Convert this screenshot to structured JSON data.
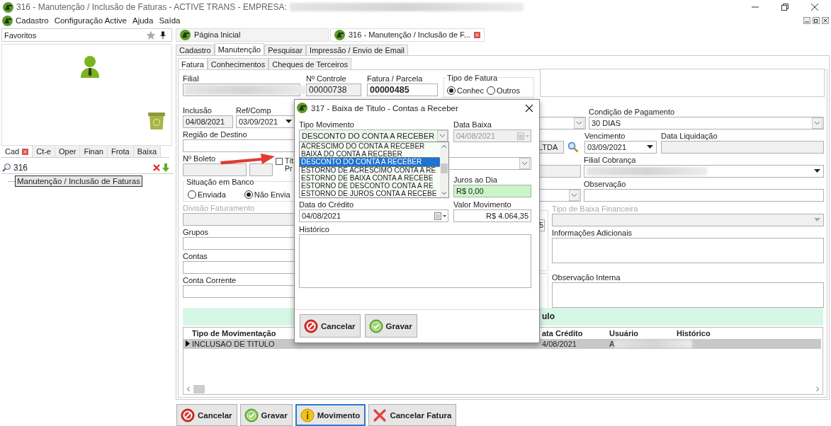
{
  "window": {
    "title": "316 - Manutenção / Inclusão de Faturas - ACTIVE TRANS - EMPRESA:"
  },
  "menu": [
    {
      "label": "Cadastro"
    },
    {
      "label": "Configuração Active"
    },
    {
      "label": "Ajuda"
    },
    {
      "label": "Saída"
    }
  ],
  "favorites": {
    "title": "Favoritos"
  },
  "side_tabs": [
    {
      "label": "Cad",
      "selected": true,
      "closable": true
    },
    {
      "label": "Ct-e",
      "selected": false,
      "closable": false
    },
    {
      "label": "Oper",
      "selected": false,
      "closable": false
    },
    {
      "label": "Finan",
      "selected": false,
      "closable": false
    },
    {
      "label": "Frota",
      "selected": false,
      "closable": false
    },
    {
      "label": "Baixa",
      "selected": false,
      "closable": false
    }
  ],
  "side_search": {
    "value": "316"
  },
  "tree": [
    {
      "label": "Manutenção / Inclusão de Faturas",
      "selected": true
    }
  ],
  "doc_tabs": [
    {
      "label": "Página Inicial",
      "selected": false,
      "closable": false
    },
    {
      "label": "316 - Manutenção / Inclusão de F...",
      "selected": true,
      "closable": true
    }
  ],
  "tabs": [
    {
      "label": "Cadastro",
      "selected": false
    },
    {
      "label": "Manutenção",
      "selected": true
    },
    {
      "label": "Pesquisar",
      "selected": false
    },
    {
      "label": "Impressão / Envio de Email",
      "selected": false
    }
  ],
  "subtabs": [
    {
      "label": "Fatura",
      "selected": true
    },
    {
      "label": "Conhecimentos",
      "selected": false
    },
    {
      "label": "Cheques de Terceiros",
      "selected": false
    }
  ],
  "form": {
    "filial": {
      "label": "Filial"
    },
    "controle": {
      "label": "Nº Controle",
      "value": "00000738"
    },
    "fatura_parcela": {
      "label": "Fatura / Parcela",
      "value": "00000485"
    },
    "tipo_fatura": {
      "label": "Tipo de Fatura",
      "options": [
        {
          "label": "Conhec",
          "selected": true
        },
        {
          "label": "Outros",
          "selected": false
        }
      ]
    },
    "inclusao": {
      "label": "Inclusão",
      "value": "04/08/2021"
    },
    "ref_comp": {
      "label": "Ref/Comp",
      "value": "03/09/2021"
    },
    "regiao_destino": {
      "label": "Região de Destino"
    },
    "boleto": {
      "label": "Nº Boleto"
    },
    "titulo_check": {
      "lines": [
        "Tít",
        "Pr"
      ],
      "checked": false
    },
    "situacao_banco": {
      "label": "Situação em Banco",
      "options": [
        {
          "label": "Enviada",
          "selected": false
        },
        {
          "label": "Não Envia",
          "selected": true
        }
      ]
    },
    "divisao": {
      "label": "Divisão Faturamento",
      "disabled": true
    },
    "grupos": {
      "label": "Grupos"
    },
    "contas": {
      "label": "Contas"
    },
    "conta_corrente": {
      "label": "Conta Corrente"
    },
    "condicao": {
      "label": "Condição de Pagamento",
      "value": "30 DIAS"
    },
    "cliente_fragment": {
      "value": "LTDA"
    },
    "vencimento": {
      "label": "Vencimento",
      "value": "03/09/2021"
    },
    "data_liquidacao": {
      "label": "Data Liquidação"
    },
    "filial_cobranca": {
      "label": "Filial Cobrança"
    },
    "observacao": {
      "label": "Observação"
    },
    "valor_fragment": {
      "value": "5"
    },
    "tipo_baixa": {
      "label": "Tipo de Baixa Financeira",
      "disabled": true
    },
    "info_adicionais": {
      "label": "Informações Adicionais"
    },
    "obs_interna": {
      "label": "Observação Interna"
    }
  },
  "band": {
    "text": "ulo"
  },
  "table": {
    "columns": [
      "Tipo de Movimentação",
      "ata Crédito",
      "Usuário",
      "Histórico"
    ],
    "rows": [
      {
        "cells": [
          "INCLUSAO DE TITULO",
          "4/08/2021",
          "A"
        ],
        "selected": true
      }
    ]
  },
  "buttons": [
    {
      "label": "Cancelar",
      "kind": "cancel",
      "focused": false
    },
    {
      "label": "Gravar",
      "kind": "save",
      "focused": false
    },
    {
      "label": "Movimento",
      "kind": "info",
      "focused": true
    },
    {
      "label": "Cancelar Fatura",
      "kind": "delete",
      "focused": false
    }
  ],
  "dialog": {
    "title": "317 - Baixa de Titulo - Contas a Receber",
    "tipo_movimento": {
      "label": "Tipo Movimento",
      "value": "DESCONTO DO CONTA A RECEBER",
      "options": [
        {
          "label": "ACRESCIMO DO CONTA A RECEBER",
          "selected": false
        },
        {
          "label": "BAIXA DO CONTA A RECEBER",
          "selected": false
        },
        {
          "label": "DESCONTO DO CONTA A RECEBER",
          "selected": true
        },
        {
          "label": "ESTORNO DE ACRESCIMO CONTA A RE",
          "selected": false
        },
        {
          "label": "ESTORNO DE BAIXA CONTA A RECEBE",
          "selected": false
        },
        {
          "label": "ESTORNO DE DESCONTO CONTA A RE",
          "selected": false
        },
        {
          "label": "ESTORNO DE JUROS CONTA A RECEBE",
          "selected": false
        }
      ]
    },
    "data_baixa": {
      "label": "Data Baixa",
      "value": "04/08/2021",
      "disabled": true
    },
    "juros": {
      "label": "Juros ao Dia",
      "value": "R$ 0,00"
    },
    "data_credito": {
      "label": "Data do Crédito",
      "value": "04/08/2021"
    },
    "valor": {
      "label": "Valor Movimento",
      "value": "R$ 4.064,35"
    },
    "historico": {
      "label": "Histórico"
    },
    "buttons": [
      {
        "label": "Cancelar",
        "kind": "cancel",
        "focused": false
      },
      {
        "label": "Gravar",
        "kind": "save",
        "focused": false
      }
    ]
  }
}
